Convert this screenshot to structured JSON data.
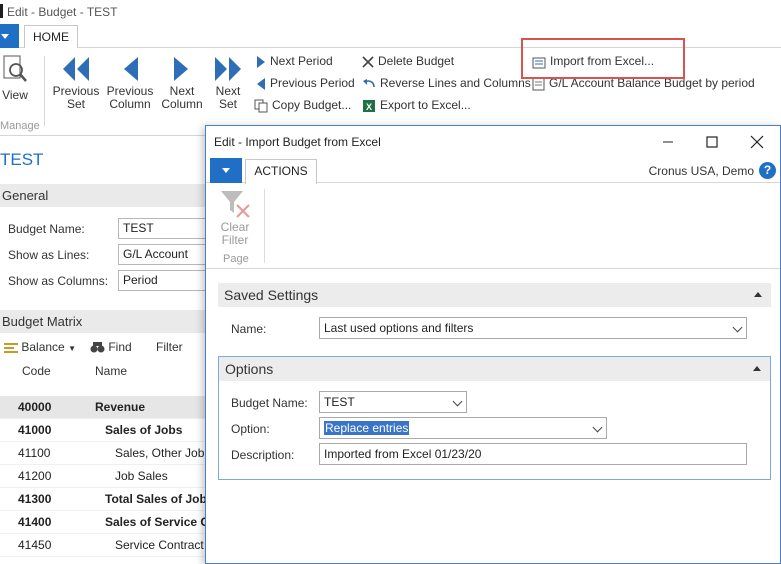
{
  "bg_window": {
    "title": "Edit - Budget - TEST",
    "home_tab": "HOME"
  },
  "ribbon": {
    "view": "View",
    "manage_group": "Manage",
    "previous_set": "Previous Set",
    "previous_column": "Previous Column",
    "next_column": "Next Column",
    "next_set": "Next Set",
    "next_period": "Next Period",
    "previous_period": "Previous Period",
    "copy_budget": "Copy Budget...",
    "delete_budget": "Delete Budget",
    "reverse_lines_columns": "Reverse Lines and Columns",
    "export_to_excel": "Export to Excel...",
    "import_from_excel": "Import from Excel...",
    "gl_balance_budget": "G/L Account Balance Budget by period"
  },
  "budget_page": {
    "title": "TEST",
    "general_section": "General",
    "budget_name_label": "Budget Name:",
    "budget_name_value": "TEST",
    "show_as_lines_label": "Show as Lines:",
    "show_as_lines_value": "G/L Account",
    "show_as_columns_label": "Show as Columns:",
    "show_as_columns_value": "Period",
    "matrix_section": "Budget Matrix",
    "toolbar": {
      "balance": "Balance",
      "find": "Find",
      "filter": "Filter"
    },
    "grid": {
      "headers": [
        "Code",
        "Name"
      ],
      "rows": [
        {
          "code": "40000",
          "name": "Revenue",
          "bold": true,
          "selected": true
        },
        {
          "code": "41000",
          "name": "Sales of Jobs",
          "bold": true
        },
        {
          "code": "41100",
          "name": "Sales, Other Job E"
        },
        {
          "code": "41200",
          "name": "Job Sales"
        },
        {
          "code": "41300",
          "name": "Total Sales of Jobs",
          "bold": true
        },
        {
          "code": "41400",
          "name": "Sales of Service Co",
          "bold": true
        },
        {
          "code": "41450",
          "name": "Service Contract"
        }
      ]
    }
  },
  "dialog": {
    "title": "Edit - Import Budget from Excel",
    "actions_tab": "ACTIONS",
    "company": "Cronus USA, Demo",
    "help": "?",
    "clear_filter": "Clear Filter",
    "page_group": "Page",
    "saved_settings": {
      "header": "Saved Settings",
      "name_label": "Name:",
      "name_value": "Last used options and filters"
    },
    "options": {
      "header": "Options",
      "budget_name_label": "Budget Name:",
      "budget_name_value": "TEST",
      "option_label": "Option:",
      "option_value": "Replace entries",
      "description_label": "Description:",
      "description_value": "Imported from Excel 01/23/20"
    }
  },
  "colors": {
    "accent": "#1f6fc5",
    "highlight_border": "#d9534f",
    "selection": "#3a74c9",
    "section_bg": "#ececec"
  }
}
